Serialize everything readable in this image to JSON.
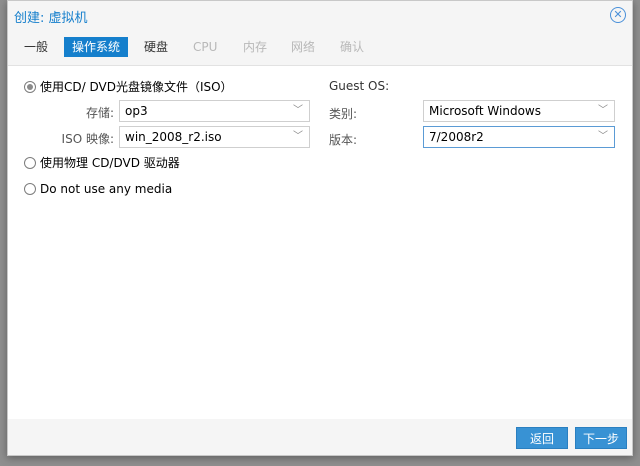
{
  "dialog": {
    "title": "创建: 虚拟机"
  },
  "tabs": [
    {
      "label": "一般",
      "state": "normal"
    },
    {
      "label": "操作系统",
      "state": "active"
    },
    {
      "label": "硬盘",
      "state": "normal"
    },
    {
      "label": "CPU",
      "state": "disabled"
    },
    {
      "label": "内存",
      "state": "disabled"
    },
    {
      "label": "网络",
      "state": "disabled"
    },
    {
      "label": "确认",
      "state": "disabled"
    }
  ],
  "media": {
    "option_cd": "使用CD/ DVD光盘镜像文件（ISO）",
    "storage_label": "存储:",
    "storage_value": "op3",
    "iso_label": "ISO 映像:",
    "iso_value": "win_2008_r2.iso",
    "option_physical": "使用物理 CD/DVD 驱动器",
    "option_none": "Do not use any media"
  },
  "guest_os": {
    "heading": "Guest OS:",
    "type_label": "类别:",
    "type_value": "Microsoft Windows",
    "version_label": "版本:",
    "version_value": "7/2008r2"
  },
  "footer": {
    "back_label": "返回",
    "next_label": "下一步"
  },
  "colors": {
    "accent": "#157fcc",
    "button": "#3892d4"
  }
}
